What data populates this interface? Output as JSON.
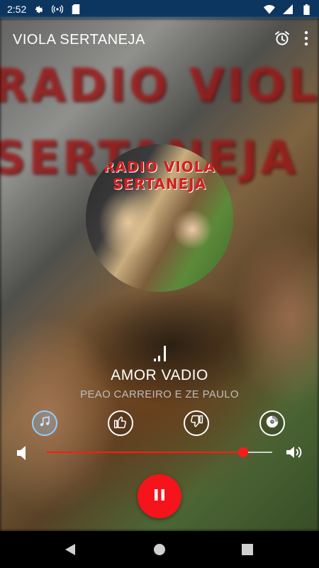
{
  "status_bar": {
    "time": "2:52",
    "icons_left": [
      "gear-icon",
      "broadcast-icon",
      "sd-card-icon"
    ],
    "icons_right": [
      "wifi-icon",
      "signal-icon",
      "battery-icon"
    ]
  },
  "app_bar": {
    "title": "VIOLA SERTANEJA",
    "actions": [
      "alarm-icon",
      "more-vert-icon"
    ]
  },
  "background": {
    "text_line1": "RADIO VIOLA",
    "text_line2": "SERTANEJA"
  },
  "album_art": {
    "line1": "RADIO VIOLA",
    "line2": "SERTANEJA"
  },
  "now_playing": {
    "title": "AMOR VADIO",
    "artist": "PEAO CARREIRO E ZE PAULO"
  },
  "actions": [
    "music-note-icon",
    "thumbs-up-icon",
    "thumbs-down-icon",
    "cd-icon"
  ],
  "volume": {
    "level": 0.87,
    "accent": "#ff1a1a"
  },
  "player": {
    "state": "playing",
    "button_color": "#f5141c"
  },
  "nav_bar": [
    "back-icon",
    "home-icon",
    "recents-icon"
  ]
}
